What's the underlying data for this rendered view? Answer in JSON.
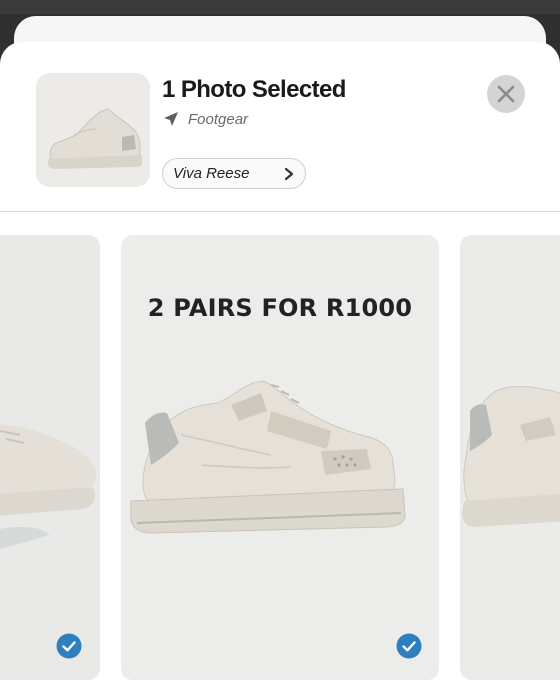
{
  "header": {
    "title": "1 Photo Selected",
    "subtitle": "Footgear",
    "account_name": "Viva Reese"
  },
  "icons": {
    "send": "send-icon",
    "chevron": "chevron-right-icon",
    "close": "close-icon",
    "check": "check-circle-icon"
  },
  "carousel": {
    "center_promo": "2 PAIRS FOR R1000"
  },
  "colors": {
    "check_blue": "#2f7fbf",
    "close_bg": "#d4d4d4"
  }
}
